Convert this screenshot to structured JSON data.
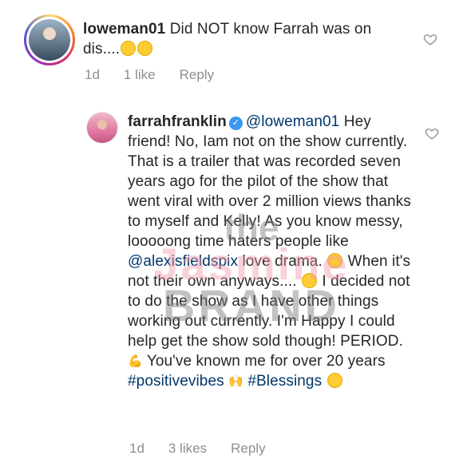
{
  "comments": [
    {
      "username": "loweman01",
      "text": "Did NOT know Farrah was on dis....",
      "time": "1d",
      "likes": "1 like",
      "reply": "Reply"
    },
    {
      "username": "farrahfranklin",
      "mention": "@loweman01",
      "text_part1": "Hey friend! No, Iam not on the show currently. That is a trailer that was recorded seven years ago for the pilot of the show that went viral with over 2 million views thanks to myself and Kelly! As you know messy, looooong time haters people like ",
      "mention2": "@alexisfieldspix",
      "text_part2": " love drama. ",
      "text_part3": " When it's not their own anyways.... ",
      "text_part4": " I decided not to do the show as I have other things working out currently. I'm Happy I could help get the show sold though! PERIOD. ",
      "text_part5": " You've known me for over 20 years ",
      "hashtag1": "#positivevibes",
      "hashtag2": "#Blessings",
      "time": "1d",
      "likes": "3 likes",
      "reply": "Reply"
    }
  ],
  "watermark": {
    "line1": "the",
    "line2": "Jasmine",
    "line3": "BRAND"
  },
  "colors": {
    "link": "#00376b",
    "meta": "#8e8e8e",
    "verified": "#3897f0"
  }
}
